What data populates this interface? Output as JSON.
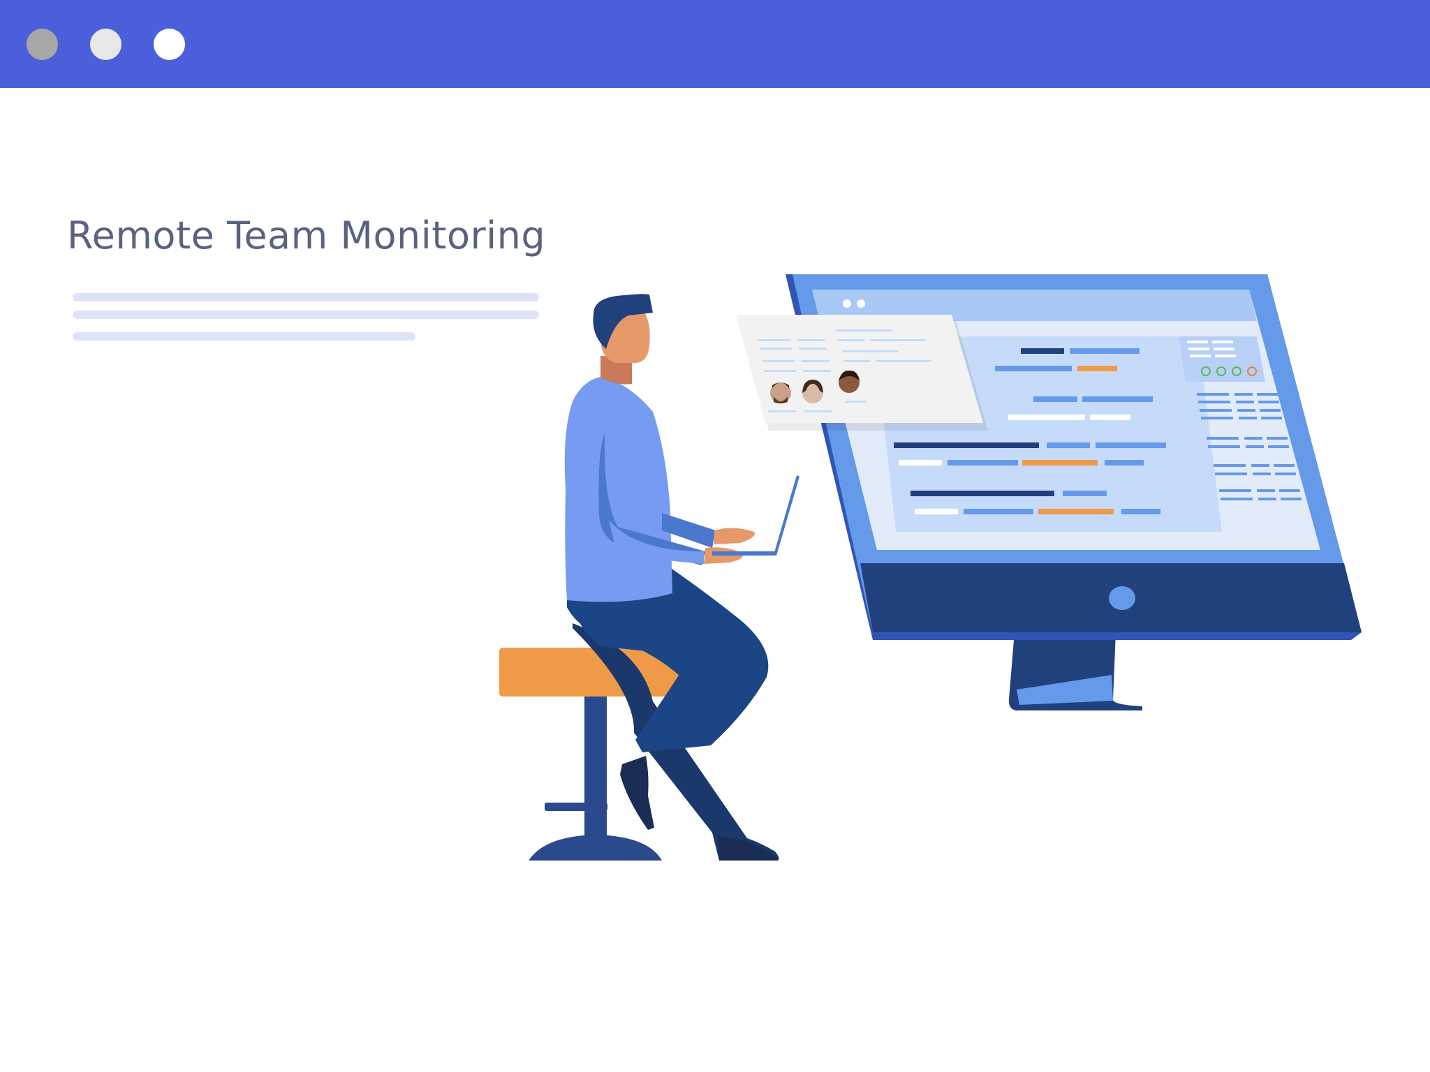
{
  "window": {
    "controls": [
      {
        "name": "close-dot",
        "color": "#a7a7a7"
      },
      {
        "name": "minimize-dot",
        "color": "#e7e7e7"
      },
      {
        "name": "maximize-dot",
        "color": "#ffffff"
      }
    ],
    "titlebar_color": "#4a5fd9"
  },
  "hero": {
    "title": "Remote Team Monitoring"
  },
  "illustration": {
    "description_icon": "person-at-computer-illustration",
    "palette": {
      "accent_orange": "#ee9a48",
      "navy": "#21417d",
      "monitor_frame": "#659aea",
      "screen_bg": "#c6dbfa",
      "shirt": "#769bf0",
      "skin": "#e5996a"
    }
  }
}
